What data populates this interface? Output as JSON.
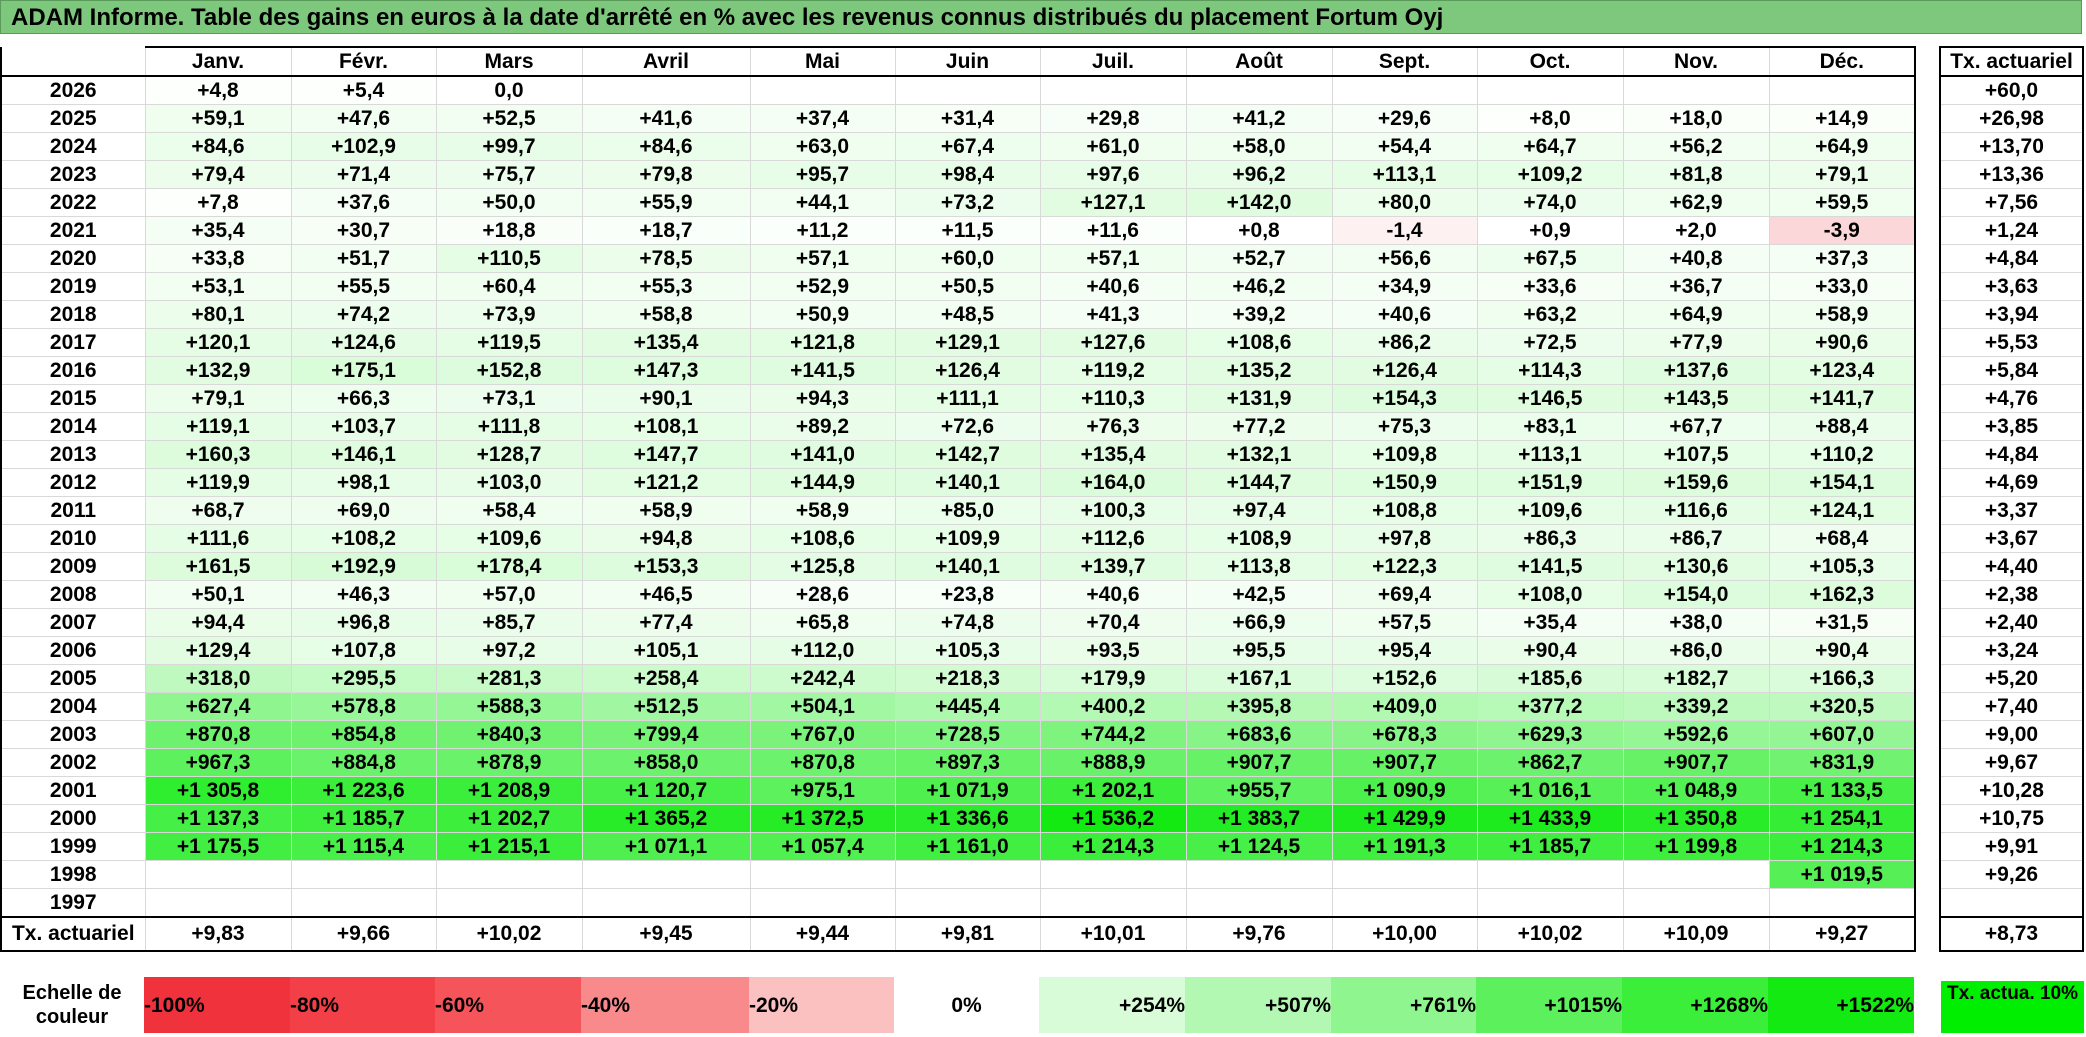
{
  "title": "ADAM Informe. Table des gains en euros à la date d'arrêté en % avec les revenus connus distribués du placement Fortum Oyj",
  "chart_data": {
    "type": "table",
    "months": [
      "Janv.",
      "Févr.",
      "Mars",
      "Avril",
      "Mai",
      "Juin",
      "Juil.",
      "Août",
      "Sept.",
      "Oct.",
      "Nov.",
      "Déc."
    ],
    "actuarial_header": "Tx. actuariel",
    "rows": [
      {
        "year": "2026",
        "values": [
          "+4,8",
          "+5,4",
          "0,0",
          "",
          "",
          "",
          "",
          "",
          "",
          "",
          "",
          ""
        ],
        "actuarial": "+60,0"
      },
      {
        "year": "2025",
        "values": [
          "+59,1",
          "+47,6",
          "+52,5",
          "+41,6",
          "+37,4",
          "+31,4",
          "+29,8",
          "+41,2",
          "+29,6",
          "+8,0",
          "+18,0",
          "+14,9"
        ],
        "actuarial": "+26,98"
      },
      {
        "year": "2024",
        "values": [
          "+84,6",
          "+102,9",
          "+99,7",
          "+84,6",
          "+63,0",
          "+67,4",
          "+61,0",
          "+58,0",
          "+54,4",
          "+64,7",
          "+56,2",
          "+64,9"
        ],
        "actuarial": "+13,70"
      },
      {
        "year": "2023",
        "values": [
          "+79,4",
          "+71,4",
          "+75,7",
          "+79,8",
          "+95,7",
          "+98,4",
          "+97,6",
          "+96,2",
          "+113,1",
          "+109,2",
          "+81,8",
          "+79,1"
        ],
        "actuarial": "+13,36"
      },
      {
        "year": "2022",
        "values": [
          "+7,8",
          "+37,6",
          "+50,0",
          "+55,9",
          "+44,1",
          "+73,2",
          "+127,1",
          "+142,0",
          "+80,0",
          "+74,0",
          "+62,9",
          "+59,5"
        ],
        "actuarial": "+7,56"
      },
      {
        "year": "2021",
        "values": [
          "+35,4",
          "+30,7",
          "+18,8",
          "+18,7",
          "+11,2",
          "+11,5",
          "+11,6",
          "+0,8",
          "-1,4",
          "+0,9",
          "+2,0",
          "-3,9"
        ],
        "actuarial": "+1,24"
      },
      {
        "year": "2020",
        "values": [
          "+33,8",
          "+51,7",
          "+110,5",
          "+78,5",
          "+57,1",
          "+60,0",
          "+57,1",
          "+52,7",
          "+56,6",
          "+67,5",
          "+40,8",
          "+37,3"
        ],
        "actuarial": "+4,84"
      },
      {
        "year": "2019",
        "values": [
          "+53,1",
          "+55,5",
          "+60,4",
          "+55,3",
          "+52,9",
          "+50,5",
          "+40,6",
          "+46,2",
          "+34,9",
          "+33,6",
          "+36,7",
          "+33,0"
        ],
        "actuarial": "+3,63"
      },
      {
        "year": "2018",
        "values": [
          "+80,1",
          "+74,2",
          "+73,9",
          "+58,8",
          "+50,9",
          "+48,5",
          "+41,3",
          "+39,2",
          "+40,6",
          "+63,2",
          "+64,9",
          "+58,9"
        ],
        "actuarial": "+3,94"
      },
      {
        "year": "2017",
        "values": [
          "+120,1",
          "+124,6",
          "+119,5",
          "+135,4",
          "+121,8",
          "+129,1",
          "+127,6",
          "+108,6",
          "+86,2",
          "+72,5",
          "+77,9",
          "+90,6"
        ],
        "actuarial": "+5,53"
      },
      {
        "year": "2016",
        "values": [
          "+132,9",
          "+175,1",
          "+152,8",
          "+147,3",
          "+141,5",
          "+126,4",
          "+119,2",
          "+135,2",
          "+126,4",
          "+114,3",
          "+137,6",
          "+123,4"
        ],
        "actuarial": "+5,84"
      },
      {
        "year": "2015",
        "values": [
          "+79,1",
          "+66,3",
          "+73,1",
          "+90,1",
          "+94,3",
          "+111,1",
          "+110,3",
          "+131,9",
          "+154,3",
          "+146,5",
          "+143,5",
          "+141,7"
        ],
        "actuarial": "+4,76"
      },
      {
        "year": "2014",
        "values": [
          "+119,1",
          "+103,7",
          "+111,8",
          "+108,1",
          "+89,2",
          "+72,6",
          "+76,3",
          "+77,2",
          "+75,3",
          "+83,1",
          "+67,7",
          "+88,4"
        ],
        "actuarial": "+3,85"
      },
      {
        "year": "2013",
        "values": [
          "+160,3",
          "+146,1",
          "+128,7",
          "+147,7",
          "+141,0",
          "+142,7",
          "+135,4",
          "+132,1",
          "+109,8",
          "+113,1",
          "+107,5",
          "+110,2"
        ],
        "actuarial": "+4,84"
      },
      {
        "year": "2012",
        "values": [
          "+119,9",
          "+98,1",
          "+103,0",
          "+121,2",
          "+144,9",
          "+140,1",
          "+164,0",
          "+144,7",
          "+150,9",
          "+151,9",
          "+159,6",
          "+154,1"
        ],
        "actuarial": "+4,69"
      },
      {
        "year": "2011",
        "values": [
          "+68,7",
          "+69,0",
          "+58,4",
          "+58,9",
          "+58,9",
          "+85,0",
          "+100,3",
          "+97,4",
          "+108,8",
          "+109,6",
          "+116,6",
          "+124,1"
        ],
        "actuarial": "+3,37"
      },
      {
        "year": "2010",
        "values": [
          "+111,6",
          "+108,2",
          "+109,6",
          "+94,8",
          "+108,6",
          "+109,9",
          "+112,6",
          "+108,9",
          "+97,8",
          "+86,3",
          "+86,7",
          "+68,4"
        ],
        "actuarial": "+3,67"
      },
      {
        "year": "2009",
        "values": [
          "+161,5",
          "+192,9",
          "+178,4",
          "+153,3",
          "+125,8",
          "+140,1",
          "+139,7",
          "+113,8",
          "+122,3",
          "+141,5",
          "+130,6",
          "+105,3"
        ],
        "actuarial": "+4,40"
      },
      {
        "year": "2008",
        "values": [
          "+50,1",
          "+46,3",
          "+57,0",
          "+46,5",
          "+28,6",
          "+23,8",
          "+40,6",
          "+42,5",
          "+69,4",
          "+108,0",
          "+154,0",
          "+162,3"
        ],
        "actuarial": "+2,38"
      },
      {
        "year": "2007",
        "values": [
          "+94,4",
          "+96,8",
          "+85,7",
          "+77,4",
          "+65,8",
          "+74,8",
          "+70,4",
          "+66,9",
          "+57,5",
          "+35,4",
          "+38,0",
          "+31,5"
        ],
        "actuarial": "+2,40"
      },
      {
        "year": "2006",
        "values": [
          "+129,4",
          "+107,8",
          "+97,2",
          "+105,1",
          "+112,0",
          "+105,3",
          "+93,5",
          "+95,5",
          "+95,4",
          "+90,4",
          "+86,0",
          "+90,4"
        ],
        "actuarial": "+3,24"
      },
      {
        "year": "2005",
        "values": [
          "+318,0",
          "+295,5",
          "+281,3",
          "+258,4",
          "+242,4",
          "+218,3",
          "+179,9",
          "+167,1",
          "+152,6",
          "+185,6",
          "+182,7",
          "+166,3"
        ],
        "actuarial": "+5,20"
      },
      {
        "year": "2004",
        "values": [
          "+627,4",
          "+578,8",
          "+588,3",
          "+512,5",
          "+504,1",
          "+445,4",
          "+400,2",
          "+395,8",
          "+409,0",
          "+377,2",
          "+339,2",
          "+320,5"
        ],
        "actuarial": "+7,40"
      },
      {
        "year": "2003",
        "values": [
          "+870,8",
          "+854,8",
          "+840,3",
          "+799,4",
          "+767,0",
          "+728,5",
          "+744,2",
          "+683,6",
          "+678,3",
          "+629,3",
          "+592,6",
          "+607,0"
        ],
        "actuarial": "+9,00"
      },
      {
        "year": "2002",
        "values": [
          "+967,3",
          "+884,8",
          "+878,9",
          "+858,0",
          "+870,8",
          "+897,3",
          "+888,9",
          "+907,7",
          "+907,7",
          "+862,7",
          "+907,7",
          "+831,9"
        ],
        "actuarial": "+9,67"
      },
      {
        "year": "2001",
        "values": [
          "+1 305,8",
          "+1 223,6",
          "+1 208,9",
          "+1 120,7",
          "+975,1",
          "+1 071,9",
          "+1 202,1",
          "+955,7",
          "+1 090,9",
          "+1 016,1",
          "+1 048,9",
          "+1 133,5"
        ],
        "actuarial": "+10,28"
      },
      {
        "year": "2000",
        "values": [
          "+1 137,3",
          "+1 185,7",
          "+1 202,7",
          "+1 365,2",
          "+1 372,5",
          "+1 336,6",
          "+1 536,2",
          "+1 383,7",
          "+1 429,9",
          "+1 433,9",
          "+1 350,8",
          "+1 254,1"
        ],
        "actuarial": "+10,75"
      },
      {
        "year": "1999",
        "values": [
          "+1 175,5",
          "+1 115,4",
          "+1 215,1",
          "+1 071,1",
          "+1 057,4",
          "+1 161,0",
          "+1 214,3",
          "+1 124,5",
          "+1 191,3",
          "+1 185,7",
          "+1 199,8",
          "+1 214,3"
        ],
        "actuarial": "+9,91"
      },
      {
        "year": "1998",
        "values": [
          "",
          "",
          "",
          "",
          "",
          "",
          "",
          "",
          "",
          "",
          "",
          "+1 019,5"
        ],
        "actuarial": "+9,26"
      },
      {
        "year": "1997",
        "values": [
          "",
          "",
          "",
          "",
          "",
          "",
          "",
          "",
          "",
          "",
          "",
          ""
        ],
        "actuarial": ""
      }
    ],
    "footer": {
      "label": "Tx. actuariel",
      "values": [
        "+9,83",
        "+9,66",
        "+10,02",
        "+9,45",
        "+9,44",
        "+9,81",
        "+10,01",
        "+9,76",
        "+10,00",
        "+10,02",
        "+10,09",
        "+9,27"
      ],
      "actuarial": "+8,73"
    },
    "color_scale": {
      "label": "Echelle de couleur",
      "steps": [
        {
          "label": "-100%",
          "color": "#f0323c"
        },
        {
          "label": "-80%",
          "color": "#f34048"
        },
        {
          "label": "-60%",
          "color": "#f5545a"
        },
        {
          "label": "-40%",
          "color": "#f88a8c"
        },
        {
          "label": "-20%",
          "color": "#fbc0c0"
        },
        {
          "label": "0%",
          "color": "#ffffff"
        },
        {
          "label": "+254%",
          "color": "#d8fcd8"
        },
        {
          "label": "+507%",
          "color": "#b2f8b2"
        },
        {
          "label": "+761%",
          "color": "#8ff58f"
        },
        {
          "label": "+1015%",
          "color": "#5cf05c"
        },
        {
          "label": "+1268%",
          "color": "#3aee3a"
        },
        {
          "label": "+1522%",
          "color": "#12ea12"
        }
      ],
      "actuarial_label": "Tx. actua. 10%",
      "actuarial_color": "#00ee00"
    }
  }
}
